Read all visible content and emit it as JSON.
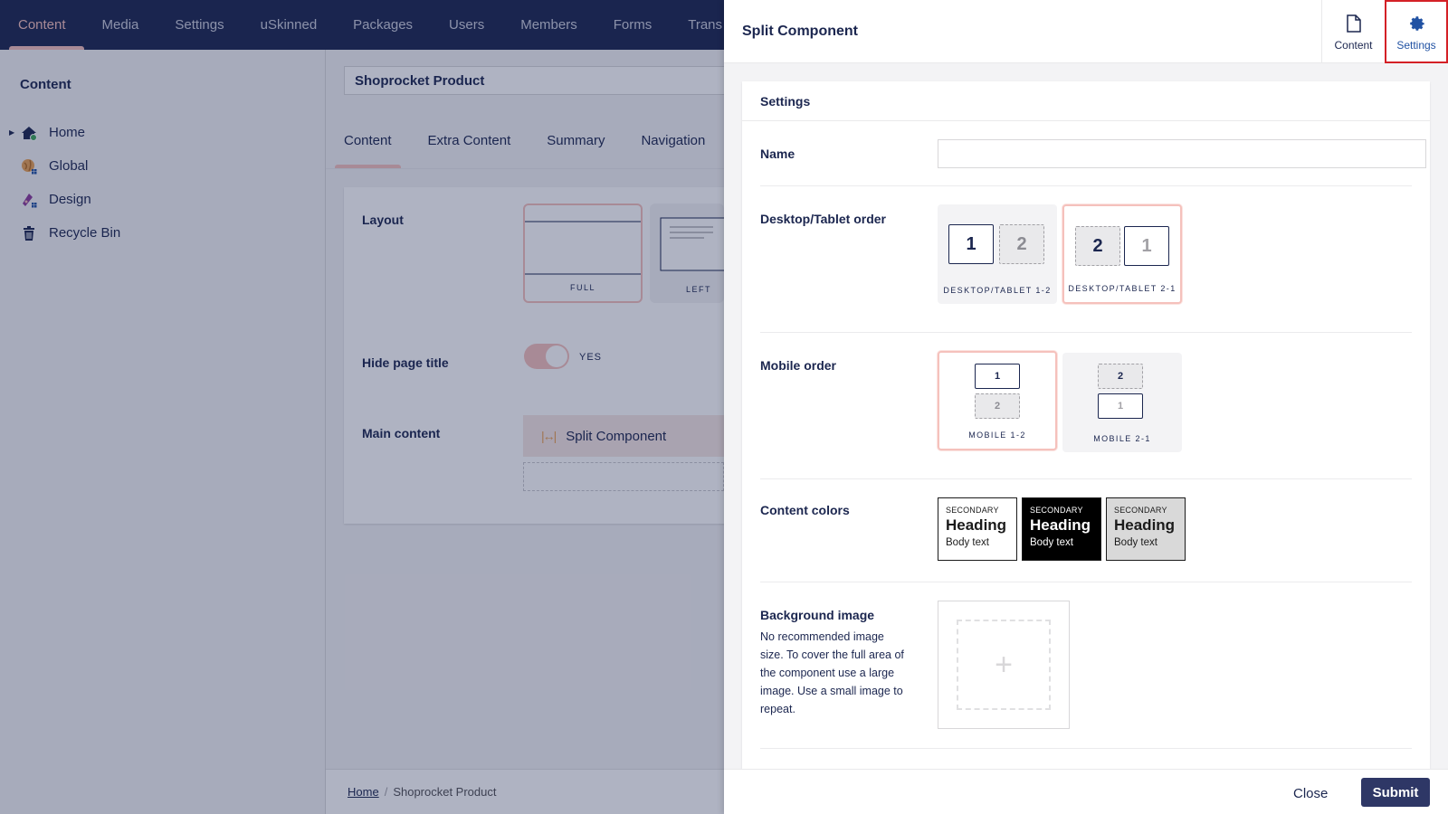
{
  "topnav": {
    "items": [
      "Content",
      "Media",
      "Settings",
      "uSkinned",
      "Packages",
      "Users",
      "Members",
      "Forms",
      "Trans"
    ]
  },
  "sidebar": {
    "title": "Content",
    "items": [
      {
        "label": "Home",
        "icon": "home-icon"
      },
      {
        "label": "Global",
        "icon": "globe-icon"
      },
      {
        "label": "Design",
        "icon": "palette-icon"
      },
      {
        "label": "Recycle Bin",
        "icon": "trash-icon"
      }
    ]
  },
  "main": {
    "node_name": "Shoprocket Product",
    "tabs": [
      "Content",
      "Extra Content",
      "Summary",
      "Navigation"
    ],
    "layout_label": "Layout",
    "layout_options": [
      "FULL",
      "LEFT"
    ],
    "hide_title_label": "Hide page title",
    "hide_title_value": "YES",
    "main_content_label": "Main content",
    "block_name": "Split Component",
    "breadcrumb": {
      "home": "Home",
      "separator": "/",
      "current": "Shoprocket Product"
    }
  },
  "editor": {
    "title": "Split Component",
    "apps": {
      "content": "Content",
      "settings": "Settings"
    },
    "section_title": "Settings",
    "name_label": "Name",
    "name_value": "",
    "desktop_label": "Desktop/Tablet order",
    "desktop_options": [
      {
        "label": "DESKTOP/TABLET 1-2",
        "first": "1",
        "second": "2"
      },
      {
        "label": "DESKTOP/TABLET 2-1",
        "first": "2",
        "second": "1"
      }
    ],
    "mobile_label": "Mobile order",
    "mobile_options": [
      {
        "label": "MOBILE 1-2",
        "first": "1",
        "second": "2"
      },
      {
        "label": "MOBILE 2-1",
        "first": "2",
        "second": "1"
      }
    ],
    "colors_label": "Content colors",
    "color_swatches": [
      {
        "secondary": "SECONDARY",
        "heading": "Heading",
        "body": "Body text",
        "bg": "#ffffff",
        "fg": "#1b1b1b"
      },
      {
        "secondary": "SECONDARY",
        "heading": "Heading",
        "body": "Body text",
        "bg": "#000000",
        "fg": "#ffffff"
      },
      {
        "secondary": "SECONDARY",
        "heading": "Heading",
        "body": "Body text",
        "bg": "#d9d9d9",
        "fg": "#1b1b1b"
      }
    ],
    "bg_image_label": "Background image",
    "bg_image_desc": "No recommended image size. To cover the full area of the component use a large image. Use a small image to repeat.",
    "footer": {
      "close": "Close",
      "submit": "Submit"
    }
  },
  "colors": {
    "brand": "#1b264f",
    "accent": "#f5c1bc",
    "highlight": "#d42026",
    "submit": "#2e3766"
  }
}
